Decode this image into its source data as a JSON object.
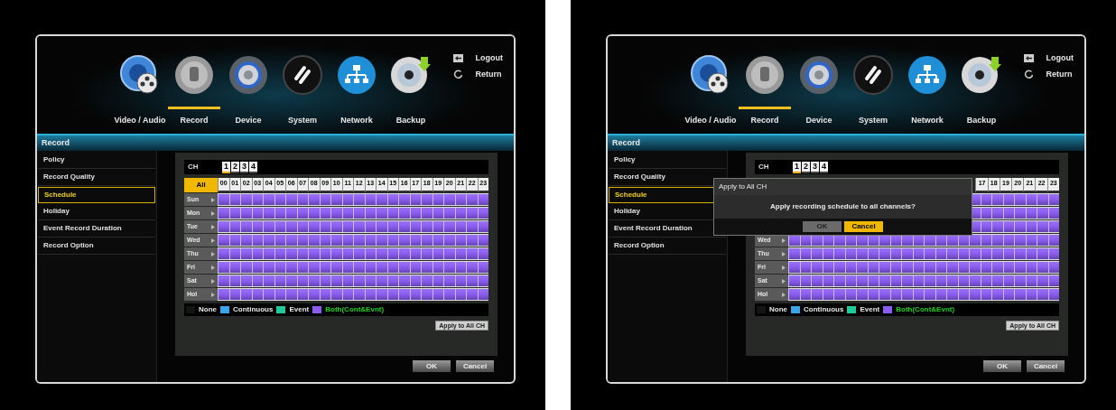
{
  "screens": [
    {
      "nav": [
        {
          "label": "Video / Audio",
          "kind": "speaker",
          "selected": false
        },
        {
          "label": "Record",
          "kind": "knob",
          "selected": true
        },
        {
          "label": "Device",
          "kind": "gear",
          "selected": false
        },
        {
          "label": "System",
          "kind": "link",
          "selected": false
        },
        {
          "label": "Network",
          "kind": "network",
          "selected": false
        },
        {
          "label": "Backup",
          "kind": "disc",
          "selected": false
        }
      ],
      "top_links": [
        {
          "label": "Logout",
          "kind": "logout"
        },
        {
          "label": "Return",
          "kind": "return"
        }
      ],
      "title_bar": "Record",
      "sidebar": [
        {
          "label": "Policy",
          "selected": false
        },
        {
          "label": "Record Quality",
          "selected": false
        },
        {
          "label": "Schedule",
          "selected": true
        },
        {
          "label": "Holiday",
          "selected": false
        },
        {
          "label": "Event Record Duration",
          "selected": false
        },
        {
          "label": "Record Option",
          "selected": false
        }
      ],
      "channel_label": "CH",
      "channels": [
        {
          "label": "1",
          "selected": true
        },
        {
          "label": "2",
          "selected": false
        },
        {
          "label": "3",
          "selected": false
        },
        {
          "label": "4",
          "selected": false
        }
      ],
      "all_button": "All",
      "hours": [
        "00",
        "01",
        "02",
        "03",
        "04",
        "05",
        "06",
        "07",
        "08",
        "09",
        "10",
        "11",
        "12",
        "13",
        "14",
        "15",
        "16",
        "17",
        "18",
        "19",
        "20",
        "21",
        "22",
        "23"
      ],
      "rows": [
        {
          "label": "Sun",
          "kind": "both"
        },
        {
          "label": "Mon",
          "kind": "both"
        },
        {
          "label": "Tue",
          "kind": "both"
        },
        {
          "label": "Wed",
          "kind": "both"
        },
        {
          "label": "Thu",
          "kind": "both"
        },
        {
          "label": "Fri",
          "kind": "both"
        },
        {
          "label": "Sat",
          "kind": "both"
        },
        {
          "label": "Hol",
          "kind": "both"
        }
      ],
      "legend": [
        {
          "label": "None",
          "color": "#141414",
          "selected": false
        },
        {
          "label": "Continuous",
          "color": "#3aa6e8",
          "selected": false
        },
        {
          "label": "Event",
          "color": "#22c99a",
          "selected": false
        },
        {
          "label": "Both(Cont&Evnt)",
          "color": "#8a5cf0",
          "selected": true
        }
      ],
      "apply_button": "Apply to All CH",
      "buttons": [
        {
          "label": "OK"
        },
        {
          "label": "Cancel"
        }
      ]
    },
    {
      "nav": [
        {
          "label": "Video / Audio",
          "kind": "speaker",
          "selected": false
        },
        {
          "label": "Record",
          "kind": "knob",
          "selected": true
        },
        {
          "label": "Device",
          "kind": "gear",
          "selected": false
        },
        {
          "label": "System",
          "kind": "link",
          "selected": false
        },
        {
          "label": "Network",
          "kind": "network",
          "selected": false
        },
        {
          "label": "Backup",
          "kind": "disc",
          "selected": false
        }
      ],
      "top_links": [
        {
          "label": "Logout",
          "kind": "logout"
        },
        {
          "label": "Return",
          "kind": "return"
        }
      ],
      "title_bar": "Record",
      "sidebar": [
        {
          "label": "Policy",
          "selected": false
        },
        {
          "label": "Record Quality",
          "selected": false
        },
        {
          "label": "Schedule",
          "selected": true
        },
        {
          "label": "Holiday",
          "selected": false
        },
        {
          "label": "Event Record Duration",
          "selected": false
        },
        {
          "label": "Record Option",
          "selected": false
        }
      ],
      "channel_label": "CH",
      "channels": [
        {
          "label": "1",
          "selected": true
        },
        {
          "label": "2",
          "selected": false
        },
        {
          "label": "3",
          "selected": false
        },
        {
          "label": "4",
          "selected": false
        }
      ],
      "hours": [
        "17",
        "18",
        "19",
        "20",
        "21",
        "22",
        "23"
      ],
      "rows": [
        {
          "kind": "both"
        },
        {
          "kind": "both"
        },
        {
          "kind": "both"
        },
        {
          "label": "Wed",
          "kind": "both"
        },
        {
          "label": "Thu",
          "kind": "both"
        },
        {
          "label": "Fri",
          "kind": "both"
        },
        {
          "label": "Sat",
          "kind": "both"
        },
        {
          "label": "Hol",
          "kind": "both"
        }
      ],
      "legend": [
        {
          "label": "None",
          "color": "#141414",
          "selected": false
        },
        {
          "label": "Continuous",
          "color": "#3aa6e8",
          "selected": false
        },
        {
          "label": "Event",
          "color": "#22c99a",
          "selected": false
        },
        {
          "label": "Both(Cont&Evnt)",
          "color": "#8a5cf0",
          "selected": true
        }
      ],
      "apply_button": "Apply to All CH",
      "buttons": [
        {
          "label": "OK"
        },
        {
          "label": "Cancel"
        }
      ],
      "dialog": {
        "title": "Apply to All CH",
        "message": "Apply recording schedule to all channels?",
        "buttons": [
          {
            "label": "OK",
            "selected": false
          },
          {
            "label": "Cancel",
            "selected": true
          }
        ]
      }
    }
  ]
}
